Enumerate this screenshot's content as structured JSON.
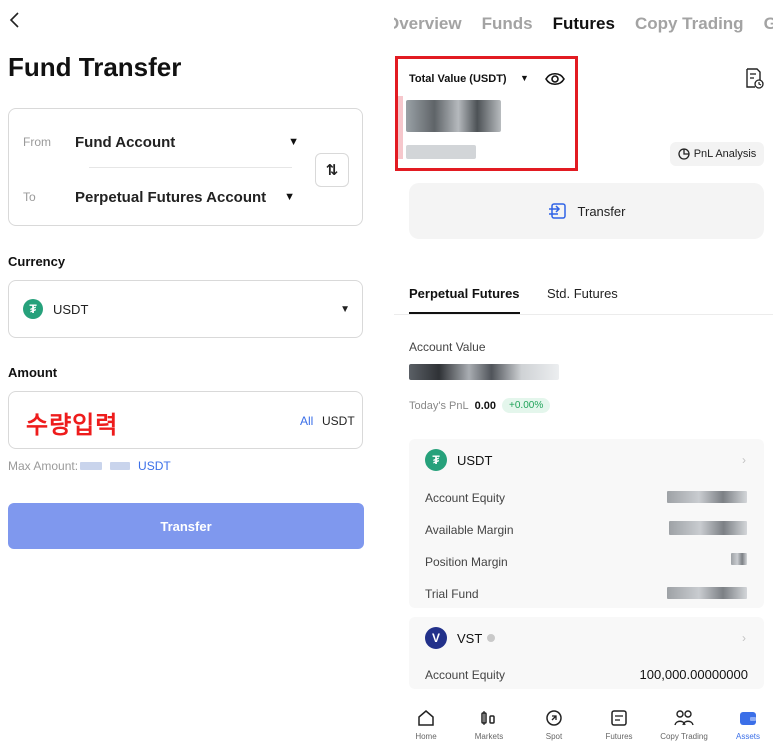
{
  "left": {
    "title": "Fund Transfer",
    "from_label": "From",
    "from_value": "Fund Account",
    "to_label": "To",
    "to_value": "Perpetual Futures Account",
    "swap_glyph": "⇅",
    "currency_label": "Currency",
    "currency_value": "USDT",
    "amount_label": "Amount",
    "amount_placeholder": "수량입력",
    "amount_all": "All",
    "amount_unit": "USDT",
    "max_label": "Max Amount:",
    "max_unit": "USDT",
    "transfer_label": "Transfer"
  },
  "right": {
    "tabs": [
      "Overview",
      "Funds",
      "Futures",
      "Copy Trading",
      "G"
    ],
    "active_tab": "Futures",
    "total_value_label": "Total Value (USDT)",
    "pnl_analysis_label": "PnL Analysis",
    "transfer_label": "Transfer",
    "subtabs": [
      "Perpetual Futures",
      "Std. Futures"
    ],
    "account_value_label": "Account Value",
    "todays_pnl_label": "Today's PnL",
    "todays_pnl_value": "0.00",
    "todays_pnl_pct": "+0.00%",
    "usdt_card": {
      "coin": "USDT",
      "rows": [
        "Account Equity",
        "Available Margin",
        "Position Margin",
        "Trial Fund"
      ]
    },
    "vst_card": {
      "coin": "VST",
      "rows": [
        {
          "label": "Account Equity",
          "value": "100,000.00000000"
        }
      ]
    },
    "bottom_nav": [
      "Home",
      "Markets",
      "Spot",
      "Futures",
      "Copy Trading",
      "Assets"
    ],
    "active_nav": "Assets"
  },
  "colors": {
    "accent_blue": "#3b6fe8",
    "transfer_button": "#7f98ee",
    "highlight_red": "#e21b22",
    "usdt_green": "#26a17b",
    "vst_navy": "#22318a",
    "pnl_green": "#21a35a"
  }
}
